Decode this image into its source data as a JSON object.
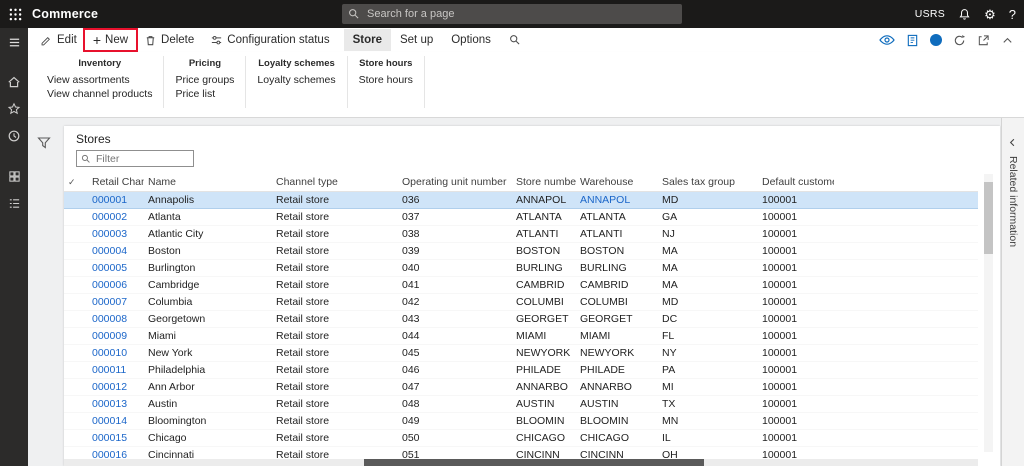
{
  "topbar": {
    "app_title": "Commerce",
    "search_placeholder": "Search for a page",
    "user_initials": "USRS"
  },
  "command_bar": {
    "buttons": {
      "edit": "Edit",
      "new": "New",
      "delete": "Delete",
      "configuration_status": "Configuration status"
    },
    "tabs": [
      "Store",
      "Set up",
      "Options"
    ]
  },
  "ribbon": {
    "groups": [
      {
        "title": "Inventory",
        "items": [
          "View assortments",
          "View channel products"
        ]
      },
      {
        "title": "Pricing",
        "items": [
          "Price groups",
          "Price list"
        ]
      },
      {
        "title": "Loyalty schemes",
        "items": [
          "Loyalty schemes"
        ]
      },
      {
        "title": "Store hours",
        "items": [
          "Store hours"
        ]
      }
    ]
  },
  "page": {
    "title": "Stores",
    "filter_placeholder": "Filter",
    "related_panel_label": "Related information"
  },
  "grid": {
    "columns": [
      "Retail Channel Id",
      "Name",
      "Channel type",
      "Operating unit number",
      "Store number",
      "Warehouse",
      "Sales tax group",
      "Default customer"
    ],
    "rows": [
      {
        "id": "000001",
        "name": "Annapolis",
        "channel_type": "Retail store",
        "operating_unit": "036",
        "store_number": "ANNAPOL",
        "warehouse": "ANNAPOL",
        "sales_tax_group": "MD",
        "default_customer": "100001",
        "selected": true
      },
      {
        "id": "000002",
        "name": "Atlanta",
        "channel_type": "Retail store",
        "operating_unit": "037",
        "store_number": "ATLANTA",
        "warehouse": "ATLANTA",
        "sales_tax_group": "GA",
        "default_customer": "100001",
        "selected": false
      },
      {
        "id": "000003",
        "name": "Atlantic City",
        "channel_type": "Retail store",
        "operating_unit": "038",
        "store_number": "ATLANTI",
        "warehouse": "ATLANTI",
        "sales_tax_group": "NJ",
        "default_customer": "100001",
        "selected": false
      },
      {
        "id": "000004",
        "name": "Boston",
        "channel_type": "Retail store",
        "operating_unit": "039",
        "store_number": "BOSTON",
        "warehouse": "BOSTON",
        "sales_tax_group": "MA",
        "default_customer": "100001",
        "selected": false
      },
      {
        "id": "000005",
        "name": "Burlington",
        "channel_type": "Retail store",
        "operating_unit": "040",
        "store_number": "BURLING",
        "warehouse": "BURLING",
        "sales_tax_group": "MA",
        "default_customer": "100001",
        "selected": false
      },
      {
        "id": "000006",
        "name": "Cambridge",
        "channel_type": "Retail store",
        "operating_unit": "041",
        "store_number": "CAMBRID",
        "warehouse": "CAMBRID",
        "sales_tax_group": "MA",
        "default_customer": "100001",
        "selected": false
      },
      {
        "id": "000007",
        "name": "Columbia",
        "channel_type": "Retail store",
        "operating_unit": "042",
        "store_number": "COLUMBI",
        "warehouse": "COLUMBI",
        "sales_tax_group": "MD",
        "default_customer": "100001",
        "selected": false
      },
      {
        "id": "000008",
        "name": "Georgetown",
        "channel_type": "Retail store",
        "operating_unit": "043",
        "store_number": "GEORGET",
        "warehouse": "GEORGET",
        "sales_tax_group": "DC",
        "default_customer": "100001",
        "selected": false
      },
      {
        "id": "000009",
        "name": "Miami",
        "channel_type": "Retail store",
        "operating_unit": "044",
        "store_number": "MIAMI",
        "warehouse": "MIAMI",
        "sales_tax_group": "FL",
        "default_customer": "100001",
        "selected": false
      },
      {
        "id": "000010",
        "name": "New York",
        "channel_type": "Retail store",
        "operating_unit": "045",
        "store_number": "NEWYORK",
        "warehouse": "NEWYORK",
        "sales_tax_group": "NY",
        "default_customer": "100001",
        "selected": false
      },
      {
        "id": "000011",
        "name": "Philadelphia",
        "channel_type": "Retail store",
        "operating_unit": "046",
        "store_number": "PHILADE",
        "warehouse": "PHILADE",
        "sales_tax_group": "PA",
        "default_customer": "100001",
        "selected": false
      },
      {
        "id": "000012",
        "name": "Ann Arbor",
        "channel_type": "Retail store",
        "operating_unit": "047",
        "store_number": "ANNARBO",
        "warehouse": "ANNARBO",
        "sales_tax_group": "MI",
        "default_customer": "100001",
        "selected": false
      },
      {
        "id": "000013",
        "name": "Austin",
        "channel_type": "Retail store",
        "operating_unit": "048",
        "store_number": "AUSTIN",
        "warehouse": "AUSTIN",
        "sales_tax_group": "TX",
        "default_customer": "100001",
        "selected": false
      },
      {
        "id": "000014",
        "name": "Bloomington",
        "channel_type": "Retail store",
        "operating_unit": "049",
        "store_number": "BLOOMIN",
        "warehouse": "BLOOMIN",
        "sales_tax_group": "MN",
        "default_customer": "100001",
        "selected": false
      },
      {
        "id": "000015",
        "name": "Chicago",
        "channel_type": "Retail store",
        "operating_unit": "050",
        "store_number": "CHICAGO",
        "warehouse": "CHICAGO",
        "sales_tax_group": "IL",
        "default_customer": "100001",
        "selected": false
      },
      {
        "id": "000016",
        "name": "Cincinnati",
        "channel_type": "Retail store",
        "operating_unit": "051",
        "store_number": "CINCINN",
        "warehouse": "CINCINN",
        "sales_tax_group": "OH",
        "default_customer": "100001",
        "selected": false
      }
    ]
  },
  "annotation": {
    "type": "highlight-box",
    "target": "new-button",
    "color": "#e8112d"
  },
  "colors": {
    "topbar_bg": "#1b1a19",
    "accent": "#0078d4",
    "link": "#1b66c9",
    "selected_row_bg": "#cfe4f8"
  }
}
